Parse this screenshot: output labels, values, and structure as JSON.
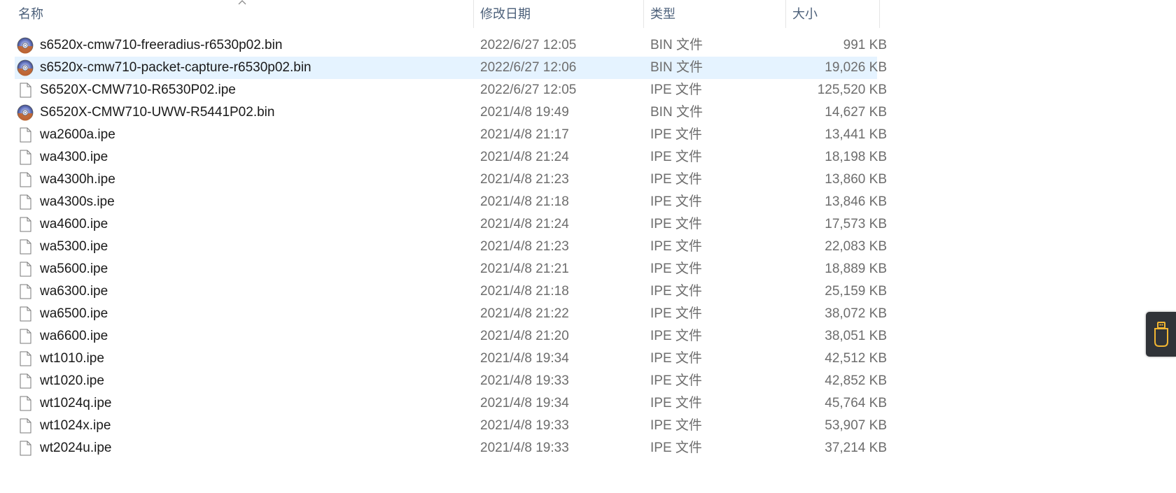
{
  "columns": {
    "name": "名称",
    "date": "修改日期",
    "type": "类型",
    "size": "大小"
  },
  "sort": {
    "column": "name",
    "icon": "sort-ascending-chevron-icon"
  },
  "selected_row": 1,
  "files": [
    {
      "name": "s6520x-cmw710-freeradius-r6530p02.bin",
      "date": "2022/6/27 12:05",
      "type": "BIN 文件",
      "size": "991 KB",
      "icon": "disc-image"
    },
    {
      "name": "s6520x-cmw710-packet-capture-r6530p02.bin",
      "date": "2022/6/27 12:06",
      "type": "BIN 文件",
      "size": "19,026 KB",
      "icon": "disc-image"
    },
    {
      "name": "S6520X-CMW710-R6530P02.ipe",
      "date": "2022/6/27 12:05",
      "type": "IPE 文件",
      "size": "125,520 KB",
      "icon": "blank-file"
    },
    {
      "name": "S6520X-CMW710-UWW-R5441P02.bin",
      "date": "2021/4/8 19:49",
      "type": "BIN 文件",
      "size": "14,627 KB",
      "icon": "disc-image"
    },
    {
      "name": "wa2600a.ipe",
      "date": "2021/4/8 21:17",
      "type": "IPE 文件",
      "size": "13,441 KB",
      "icon": "blank-file"
    },
    {
      "name": "wa4300.ipe",
      "date": "2021/4/8 21:24",
      "type": "IPE 文件",
      "size": "18,198 KB",
      "icon": "blank-file"
    },
    {
      "name": "wa4300h.ipe",
      "date": "2021/4/8 21:23",
      "type": "IPE 文件",
      "size": "13,860 KB",
      "icon": "blank-file"
    },
    {
      "name": "wa4300s.ipe",
      "date": "2021/4/8 21:18",
      "type": "IPE 文件",
      "size": "13,846 KB",
      "icon": "blank-file"
    },
    {
      "name": "wa4600.ipe",
      "date": "2021/4/8 21:24",
      "type": "IPE 文件",
      "size": "17,573 KB",
      "icon": "blank-file"
    },
    {
      "name": "wa5300.ipe",
      "date": "2021/4/8 21:23",
      "type": "IPE 文件",
      "size": "22,083 KB",
      "icon": "blank-file"
    },
    {
      "name": "wa5600.ipe",
      "date": "2021/4/8 21:21",
      "type": "IPE 文件",
      "size": "18,889 KB",
      "icon": "blank-file"
    },
    {
      "name": "wa6300.ipe",
      "date": "2021/4/8 21:18",
      "type": "IPE 文件",
      "size": "25,159 KB",
      "icon": "blank-file"
    },
    {
      "name": "wa6500.ipe",
      "date": "2021/4/8 21:22",
      "type": "IPE 文件",
      "size": "38,072 KB",
      "icon": "blank-file"
    },
    {
      "name": "wa6600.ipe",
      "date": "2021/4/8 21:20",
      "type": "IPE 文件",
      "size": "38,051 KB",
      "icon": "blank-file"
    },
    {
      "name": "wt1010.ipe",
      "date": "2021/4/8 19:34",
      "type": "IPE 文件",
      "size": "42,512 KB",
      "icon": "blank-file"
    },
    {
      "name": "wt1020.ipe",
      "date": "2021/4/8 19:33",
      "type": "IPE 文件",
      "size": "42,852 KB",
      "icon": "blank-file"
    },
    {
      "name": "wt1024q.ipe",
      "date": "2021/4/8 19:34",
      "type": "IPE 文件",
      "size": "45,764 KB",
      "icon": "blank-file"
    },
    {
      "name": "wt1024x.ipe",
      "date": "2021/4/8 19:33",
      "type": "IPE 文件",
      "size": "53,907 KB",
      "icon": "blank-file"
    },
    {
      "name": "wt2024u.ipe",
      "date": "2021/4/8 19:33",
      "type": "IPE 文件",
      "size": "37,214 KB",
      "icon": "blank-file"
    }
  ],
  "side_widget": {
    "icon": "usb-drive-icon",
    "accent": "#f2b632"
  },
  "colors": {
    "selection": "#e5f3ff",
    "header_text": "#4c607a",
    "secondary_text": "#6d6d6d"
  }
}
